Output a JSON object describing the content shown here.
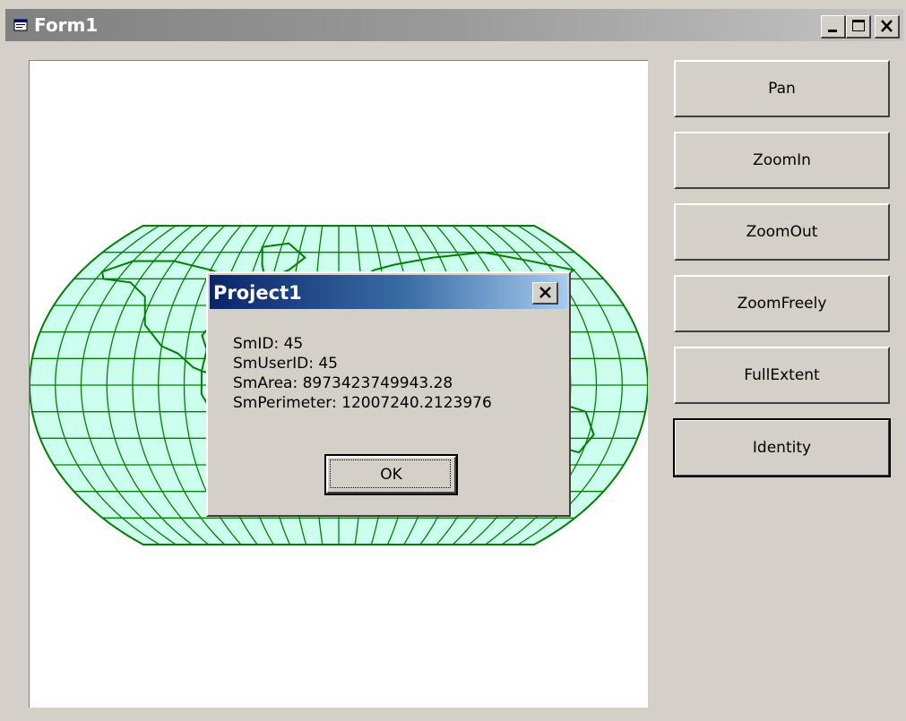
{
  "window": {
    "title": "Form1",
    "minimize_label": "minimize",
    "maximize_label": "maximize",
    "close_label": "close"
  },
  "toolbar": {
    "buttons": [
      {
        "label": "Pan"
      },
      {
        "label": "ZoomIn"
      },
      {
        "label": "ZoomOut"
      },
      {
        "label": "ZoomFreely"
      },
      {
        "label": "FullExtent"
      },
      {
        "label": "Identity"
      }
    ]
  },
  "map": {
    "fill_color": "#ccffee",
    "line_color": "#008000"
  },
  "dialog": {
    "title": "Project1",
    "lines": [
      "SmID: 45",
      "SmUserID: 45",
      "SmArea: 8973423749943.28",
      "SmPerimeter: 12007240.2123976"
    ],
    "ok_label": "OK"
  },
  "colors": {
    "face": "#d4d0c8",
    "active_title_start": "#0a246a",
    "active_title_end": "#a6caf0",
    "inactive_title": "#808080"
  }
}
